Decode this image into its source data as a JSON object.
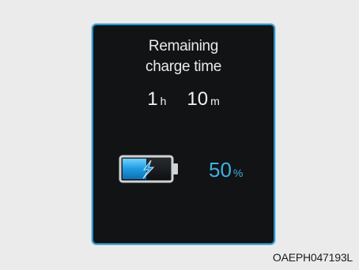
{
  "panel": {
    "title_line1": "Remaining",
    "title_line2": "charge time",
    "hours_value": "1",
    "hours_unit": "h",
    "minutes_value": "10",
    "minutes_unit": "m",
    "battery_icon": "charging-battery-icon",
    "battery_level": 0.5,
    "percent_value": "50",
    "percent_unit": "%"
  },
  "image_code": "OAEPH047193L",
  "colors": {
    "panel_background": "#111315",
    "panel_border": "#2a95c9",
    "accent_blue": "#3fb0e2",
    "text_white": "#e9e9e9",
    "page_background": "#ebebeb"
  }
}
